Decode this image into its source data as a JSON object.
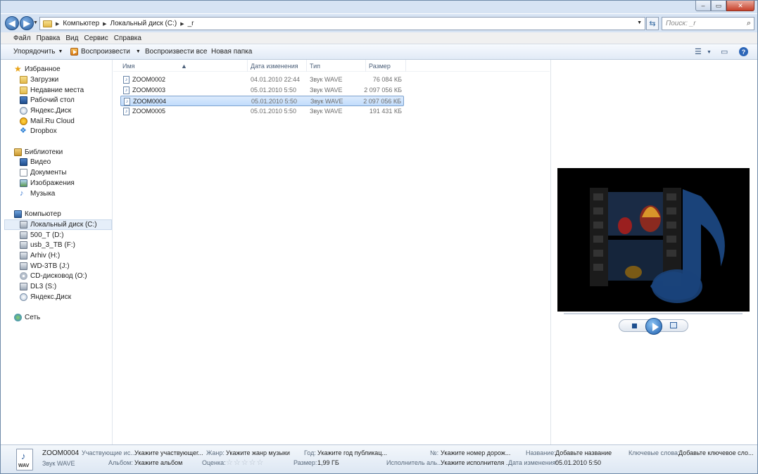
{
  "window": {
    "min_glyph": "–",
    "max_glyph": "▭",
    "close_glyph": "✕"
  },
  "address": {
    "crumbs": [
      "Компьютер",
      "Локальный диск (C:)",
      "_r"
    ],
    "search_placeholder": "Поиск: _r"
  },
  "menu": [
    "Файл",
    "Правка",
    "Вид",
    "Сервис",
    "Справка"
  ],
  "commands": {
    "organize": "Упорядочить",
    "play": "Воспроизвести",
    "play_all": "Воспроизвести все",
    "new_folder": "Новая папка",
    "help_glyph": "?"
  },
  "nav": {
    "favorites": {
      "label": "Избранное",
      "items": [
        "Загрузки",
        "Недавние места",
        "Рабочий стол",
        "Яндекс.Диск",
        "Mail.Ru Cloud",
        "Dropbox"
      ]
    },
    "libraries": {
      "label": "Библиотеки",
      "items": [
        "Видео",
        "Документы",
        "Изображения",
        "Музыка"
      ]
    },
    "computer": {
      "label": "Компьютер",
      "items": [
        "Локальный диск (C:)",
        "500_T (D:)",
        "usb_3_TB (F:)",
        "Arhiv (H:)",
        "WD-3TB (J:)",
        "CD-дисковод (O:)",
        "DL3 (S:)",
        "Яндекс.Диск"
      ]
    },
    "network": {
      "label": "Сеть"
    }
  },
  "columns": {
    "name": "Имя",
    "date": "Дата изменения",
    "type": "Тип",
    "size": "Размер"
  },
  "files": [
    {
      "name": "ZOOM0002",
      "date": "04.01.2010 22:44",
      "type": "Звук WAVE",
      "size": "76 084 КБ"
    },
    {
      "name": "ZOOM0003",
      "date": "05.01.2010 5:50",
      "type": "Звук WAVE",
      "size": "2 097 056 КБ"
    },
    {
      "name": "ZOOM0004",
      "date": "05.01.2010 5:50",
      "type": "Звук WAVE",
      "size": "2 097 056 КБ"
    },
    {
      "name": "ZOOM0005",
      "date": "05.01.2010 5:50",
      "type": "Звук WAVE",
      "size": "191 431 КБ"
    }
  ],
  "selected_file_index": 2,
  "details": {
    "filename": "ZOOM0004",
    "filetype": "Звук WAVE",
    "icon_tag": "WAV",
    "artists_label": "Участвующие ис...",
    "artists_value": "Укажите участвующег...",
    "genre_label": "Жанр:",
    "genre_value": "Укажите жанр музыки",
    "year_label": "Год:",
    "year_value": "Укажите год публикац...",
    "track_label": "№:",
    "track_value": "Укажите номер дорож...",
    "title_label": "Название:",
    "title_value": "Добавьте название",
    "keywords_label": "Ключевые слова:",
    "keywords_value": "Добавьте ключевое сло...",
    "album_label": "Альбом:",
    "album_value": "Укажите альбом",
    "rating_label": "Оценка:",
    "rating_value": "☆☆☆☆☆",
    "size_label": "Размер:",
    "size_value": "1,99 ГБ",
    "album_artist_label": "Исполнитель аль...",
    "album_artist_value": "Укажите исполнителя ...",
    "modified_label": "Дата изменения:",
    "modified_value": "05.01.2010 5:50"
  }
}
